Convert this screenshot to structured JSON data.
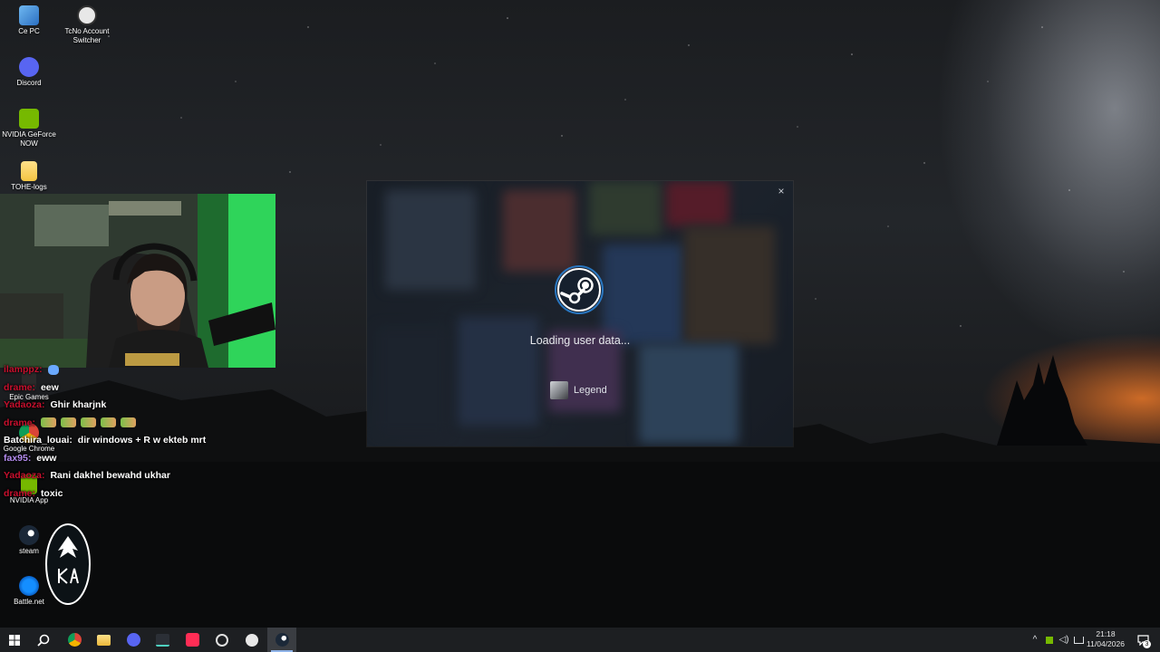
{
  "desktop": {
    "icons": [
      {
        "label": "Ce PC",
        "icon": "computer-icon"
      },
      {
        "label": "TcNo Account Switcher",
        "icon": "tcno-icon"
      },
      {
        "label": "Discord",
        "icon": "discord-icon"
      },
      {
        "label": "NVIDIA GeForce NOW",
        "icon": "geforce-now-icon"
      },
      {
        "label": "TOHE-logs",
        "icon": "folder-icon"
      },
      {
        "label": "Epic Games",
        "icon": "epic-games-icon"
      },
      {
        "label": "Google Chrome",
        "icon": "chrome-icon"
      },
      {
        "label": "NVIDIA App",
        "icon": "nvidia-app-icon"
      },
      {
        "label": "steam",
        "icon": "steam-icon"
      },
      {
        "label": "Battle.net",
        "icon": "battlenet-icon"
      }
    ]
  },
  "chat": {
    "messages": [
      {
        "user": "ilamppz:",
        "text": "",
        "user_color": "#c8102e"
      },
      {
        "user": "drame:",
        "text": "eew",
        "user_color": "#c8102e"
      },
      {
        "user": "Yadaoza:",
        "text": "Ghir kharjnk",
        "user_color": "#c8102e"
      },
      {
        "user": "drame:",
        "text": "",
        "user_color": "#c8102e"
      },
      {
        "user": "Batchira_louai:",
        "text": "dir windows + R w ekteb mrt",
        "user_color": "#ffffff"
      },
      {
        "user": "fax95:",
        "text": "eww",
        "user_color": "#b58cf0"
      },
      {
        "user": "Yadaoza:",
        "text": "Rani dakhel bewahd ukhar",
        "user_color": "#c8102e"
      },
      {
        "user": "drame:",
        "text": "toxic",
        "user_color": "#c8102e"
      }
    ]
  },
  "steam_dialog": {
    "status": "Loading user data...",
    "account_name": "Legend",
    "close_icon": "×"
  },
  "taskbar": {
    "time": "21:18",
    "date": "11/04/2026",
    "notification_count": "3",
    "apps": [
      "start-icon",
      "search-icon",
      "chrome-icon",
      "file-explorer-icon",
      "discord-icon",
      "terminal-icon",
      "tiktok-icon",
      "obs-icon",
      "github-icon",
      "steam-icon"
    ]
  },
  "colors": {
    "taskbar_bg": "#1d1f22",
    "accent": "#8fb3e8",
    "sunset": "#e8782a"
  }
}
